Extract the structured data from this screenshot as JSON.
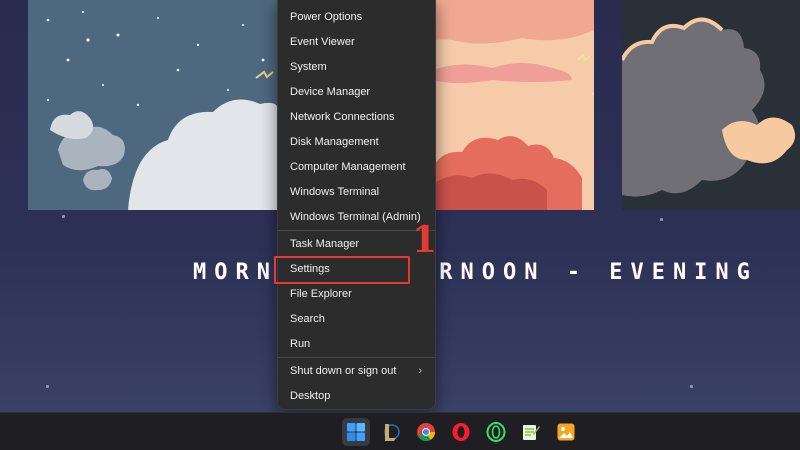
{
  "wallpaper": {
    "text_left": "MORN",
    "text_right": "ERNOON - EVENING"
  },
  "context_menu": {
    "groups": [
      [
        "Power Options",
        "Event Viewer",
        "System",
        "Device Manager",
        "Network Connections",
        "Disk Management",
        "Computer Management",
        "Windows Terminal",
        "Windows Terminal (Admin)"
      ],
      [
        "Task Manager",
        "Settings",
        "File Explorer",
        "Search",
        "Run"
      ],
      [
        "Shut down or sign out",
        "Desktop"
      ]
    ],
    "submenu_arrow": "›",
    "highlighted_item": "Settings"
  },
  "annotation": {
    "step_number": "1",
    "color": "#e53935"
  },
  "taskbar": {
    "icons": [
      "windows-start-icon",
      "league-of-legends-icon",
      "chrome-icon",
      "opera-icon",
      "opera-gx-icon",
      "notepad-plus-plus-icon",
      "image-viewer-icon"
    ]
  },
  "colors": {
    "menu_bg": "#2c2c2c",
    "menu_text": "#f1f1f1",
    "taskbar_bg": "#1f1f23",
    "desktop_bg": "#2b2f52"
  }
}
